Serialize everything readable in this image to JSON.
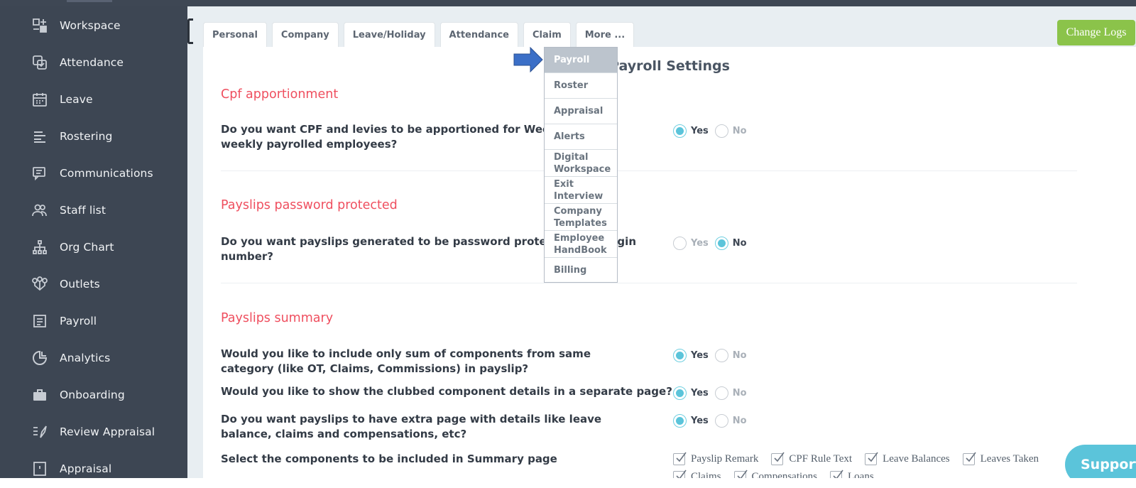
{
  "sidebar": {
    "items": [
      {
        "label": "Workspace",
        "icon": "workspace-icon"
      },
      {
        "label": "Attendance",
        "icon": "attendance-icon"
      },
      {
        "label": "Leave",
        "icon": "calendar-icon"
      },
      {
        "label": "Rostering",
        "icon": "rostering-icon"
      },
      {
        "label": "Communications",
        "icon": "chat-icon"
      },
      {
        "label": "Staff list",
        "icon": "staff-icon"
      },
      {
        "label": "Org Chart",
        "icon": "org-chart-icon"
      },
      {
        "label": "Outlets",
        "icon": "outlets-icon"
      },
      {
        "label": "Payroll",
        "icon": "payroll-icon"
      },
      {
        "label": "Analytics",
        "icon": "analytics-icon"
      },
      {
        "label": "Onboarding",
        "icon": "briefcase-icon"
      },
      {
        "label": "Review Appraisal",
        "icon": "review-icon"
      },
      {
        "label": "Appraisal",
        "icon": "appraisal-icon"
      }
    ]
  },
  "tabs": [
    "Personal",
    "Company",
    "Leave/Holiday",
    "Attendance",
    "Claim",
    "More ..."
  ],
  "header": {
    "change_logs": "Change Logs"
  },
  "page": {
    "title": "Payroll Settings"
  },
  "sections": [
    {
      "title": "Cpf apportionment",
      "questions": [
        {
          "text": "Do you want CPF and levies to be apportioned for Weekly and Bi-weekly payrolled employees?",
          "selected": "Yes"
        }
      ]
    },
    {
      "title": "Payslips password protected",
      "questions": [
        {
          "text": "Do you want payslips generated to be password protected with login number?",
          "selected": "No"
        }
      ]
    },
    {
      "title": "Payslips summary",
      "questions": [
        {
          "text": "Would you like to include only sum of components from same category (like OT, Claims, Commissions) in payslip?",
          "selected": "Yes"
        },
        {
          "text": "Would you like to show the clubbed component details in a separate page?",
          "selected": "Yes"
        },
        {
          "text": "Do you want payslips to have extra page with details like leave balance, claims and compensations, etc?",
          "selected": "Yes"
        },
        {
          "text": "Select the components to be included in Summary page"
        }
      ]
    }
  ],
  "radio_labels": {
    "yes": "Yes",
    "no": "No"
  },
  "summary_components": [
    "Payslip Remark",
    "CPF Rule Text",
    "Leave Balances",
    "Leaves Taken"
  ],
  "summary_components_row2": [
    "Claims",
    "Compensations",
    "Loans"
  ],
  "more_menu": {
    "items": [
      "Payroll",
      "Roster",
      "Appraisal",
      "Alerts",
      "Digital Workspace",
      "Exit Interview",
      "Company Templates",
      "Employee HandBook",
      "Billing"
    ],
    "active": "Payroll"
  },
  "support": {
    "label": "Support"
  },
  "colors": {
    "sidebar": "#3d4653",
    "accent": "#5bc4da",
    "section_title": "#ef4f5f",
    "change_logs": "#8bc34a",
    "arrow": "#3b6fc7"
  }
}
